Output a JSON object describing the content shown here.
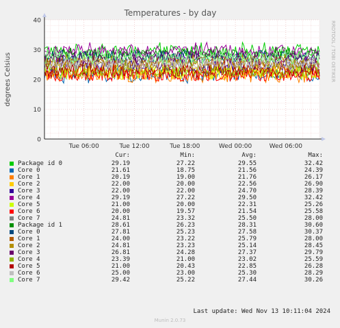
{
  "chart_data": {
    "type": "line",
    "title": "Temperatures - by day",
    "ylabel": "degrees Celsius",
    "ylim": [
      0,
      40
    ],
    "yticks": [
      "0",
      "10",
      "20",
      "30",
      "40"
    ],
    "xticks": [
      "Tue 06:00",
      "Tue 12:00",
      "Tue 18:00",
      "Wed 00:00",
      "Wed 06:00"
    ],
    "xtick_hours": [
      6,
      12,
      18,
      24,
      30
    ],
    "x_range_hours": [
      1.3,
      34.0
    ],
    "grid": true,
    "watermark": "RRDTOOL / TOBI OETIKER",
    "legend_header": {
      "cur": "Cur:",
      "min": "Min:",
      "avg": "Avg:",
      "max": "Max:"
    },
    "series": [
      {
        "name": "Package id 0",
        "color": "#00cc00",
        "cur": "29.19",
        "min": "27.22",
        "avg": "29.55",
        "max": "32.42"
      },
      {
        "name": "Core 0",
        "color": "#0066b3",
        "cur": "21.61",
        "min": "18.75",
        "avg": "21.56",
        "max": "24.39"
      },
      {
        "name": "Core 1",
        "color": "#ff8000",
        "cur": "20.19",
        "min": "19.00",
        "avg": "21.76",
        "max": "26.17"
      },
      {
        "name": "Core 2",
        "color": "#ffcc00",
        "cur": "22.00",
        "min": "20.00",
        "avg": "22.56",
        "max": "26.90"
      },
      {
        "name": "Core 3",
        "color": "#330099",
        "cur": "22.00",
        "min": "22.00",
        "avg": "24.70",
        "max": "28.39"
      },
      {
        "name": "Core 4",
        "color": "#990099",
        "cur": "29.19",
        "min": "27.22",
        "avg": "29.50",
        "max": "32.42"
      },
      {
        "name": "Core 5",
        "color": "#ccff00",
        "cur": "21.00",
        "min": "20.00",
        "avg": "22.31",
        "max": "25.26"
      },
      {
        "name": "Core 6",
        "color": "#ff0000",
        "cur": "20.00",
        "min": "19.57",
        "avg": "21.54",
        "max": "25.58"
      },
      {
        "name": "Core 7",
        "color": "#808080",
        "cur": "24.81",
        "min": "23.32",
        "avg": "25.50",
        "max": "28.00"
      },
      {
        "name": "Package id 1",
        "color": "#008f00",
        "cur": "28.61",
        "min": "26.23",
        "avg": "28.31",
        "max": "30.60"
      },
      {
        "name": "Core 0",
        "color": "#00487d",
        "cur": "27.81",
        "min": "25.23",
        "avg": "27.58",
        "max": "30.37"
      },
      {
        "name": "Core 1",
        "color": "#b35a00",
        "cur": "24.00",
        "min": "23.22",
        "avg": "25.79",
        "max": "28.00"
      },
      {
        "name": "Core 2",
        "color": "#b38f00",
        "cur": "24.81",
        "min": "23.23",
        "avg": "25.14",
        "max": "28.45"
      },
      {
        "name": "Core 3",
        "color": "#6b006b",
        "cur": "26.81",
        "min": "24.28",
        "avg": "27.37",
        "max": "29.79"
      },
      {
        "name": "Core 4",
        "color": "#8fb300",
        "cur": "23.39",
        "min": "21.00",
        "avg": "23.02",
        "max": "25.59"
      },
      {
        "name": "Core 5",
        "color": "#b30000",
        "cur": "21.00",
        "min": "20.43",
        "avg": "22.85",
        "max": "26.28"
      },
      {
        "name": "Core 6",
        "color": "#bebebe",
        "cur": "25.00",
        "min": "23.00",
        "avg": "25.30",
        "max": "28.29"
      },
      {
        "name": "Core 7",
        "color": "#80ff80",
        "cur": "29.42",
        "min": "25.22",
        "avg": "27.44",
        "max": "30.26"
      }
    ]
  },
  "footer": {
    "last_update": "Last update: Wed Nov 13 10:11:04 2024",
    "version": "Munin 2.0.73"
  }
}
